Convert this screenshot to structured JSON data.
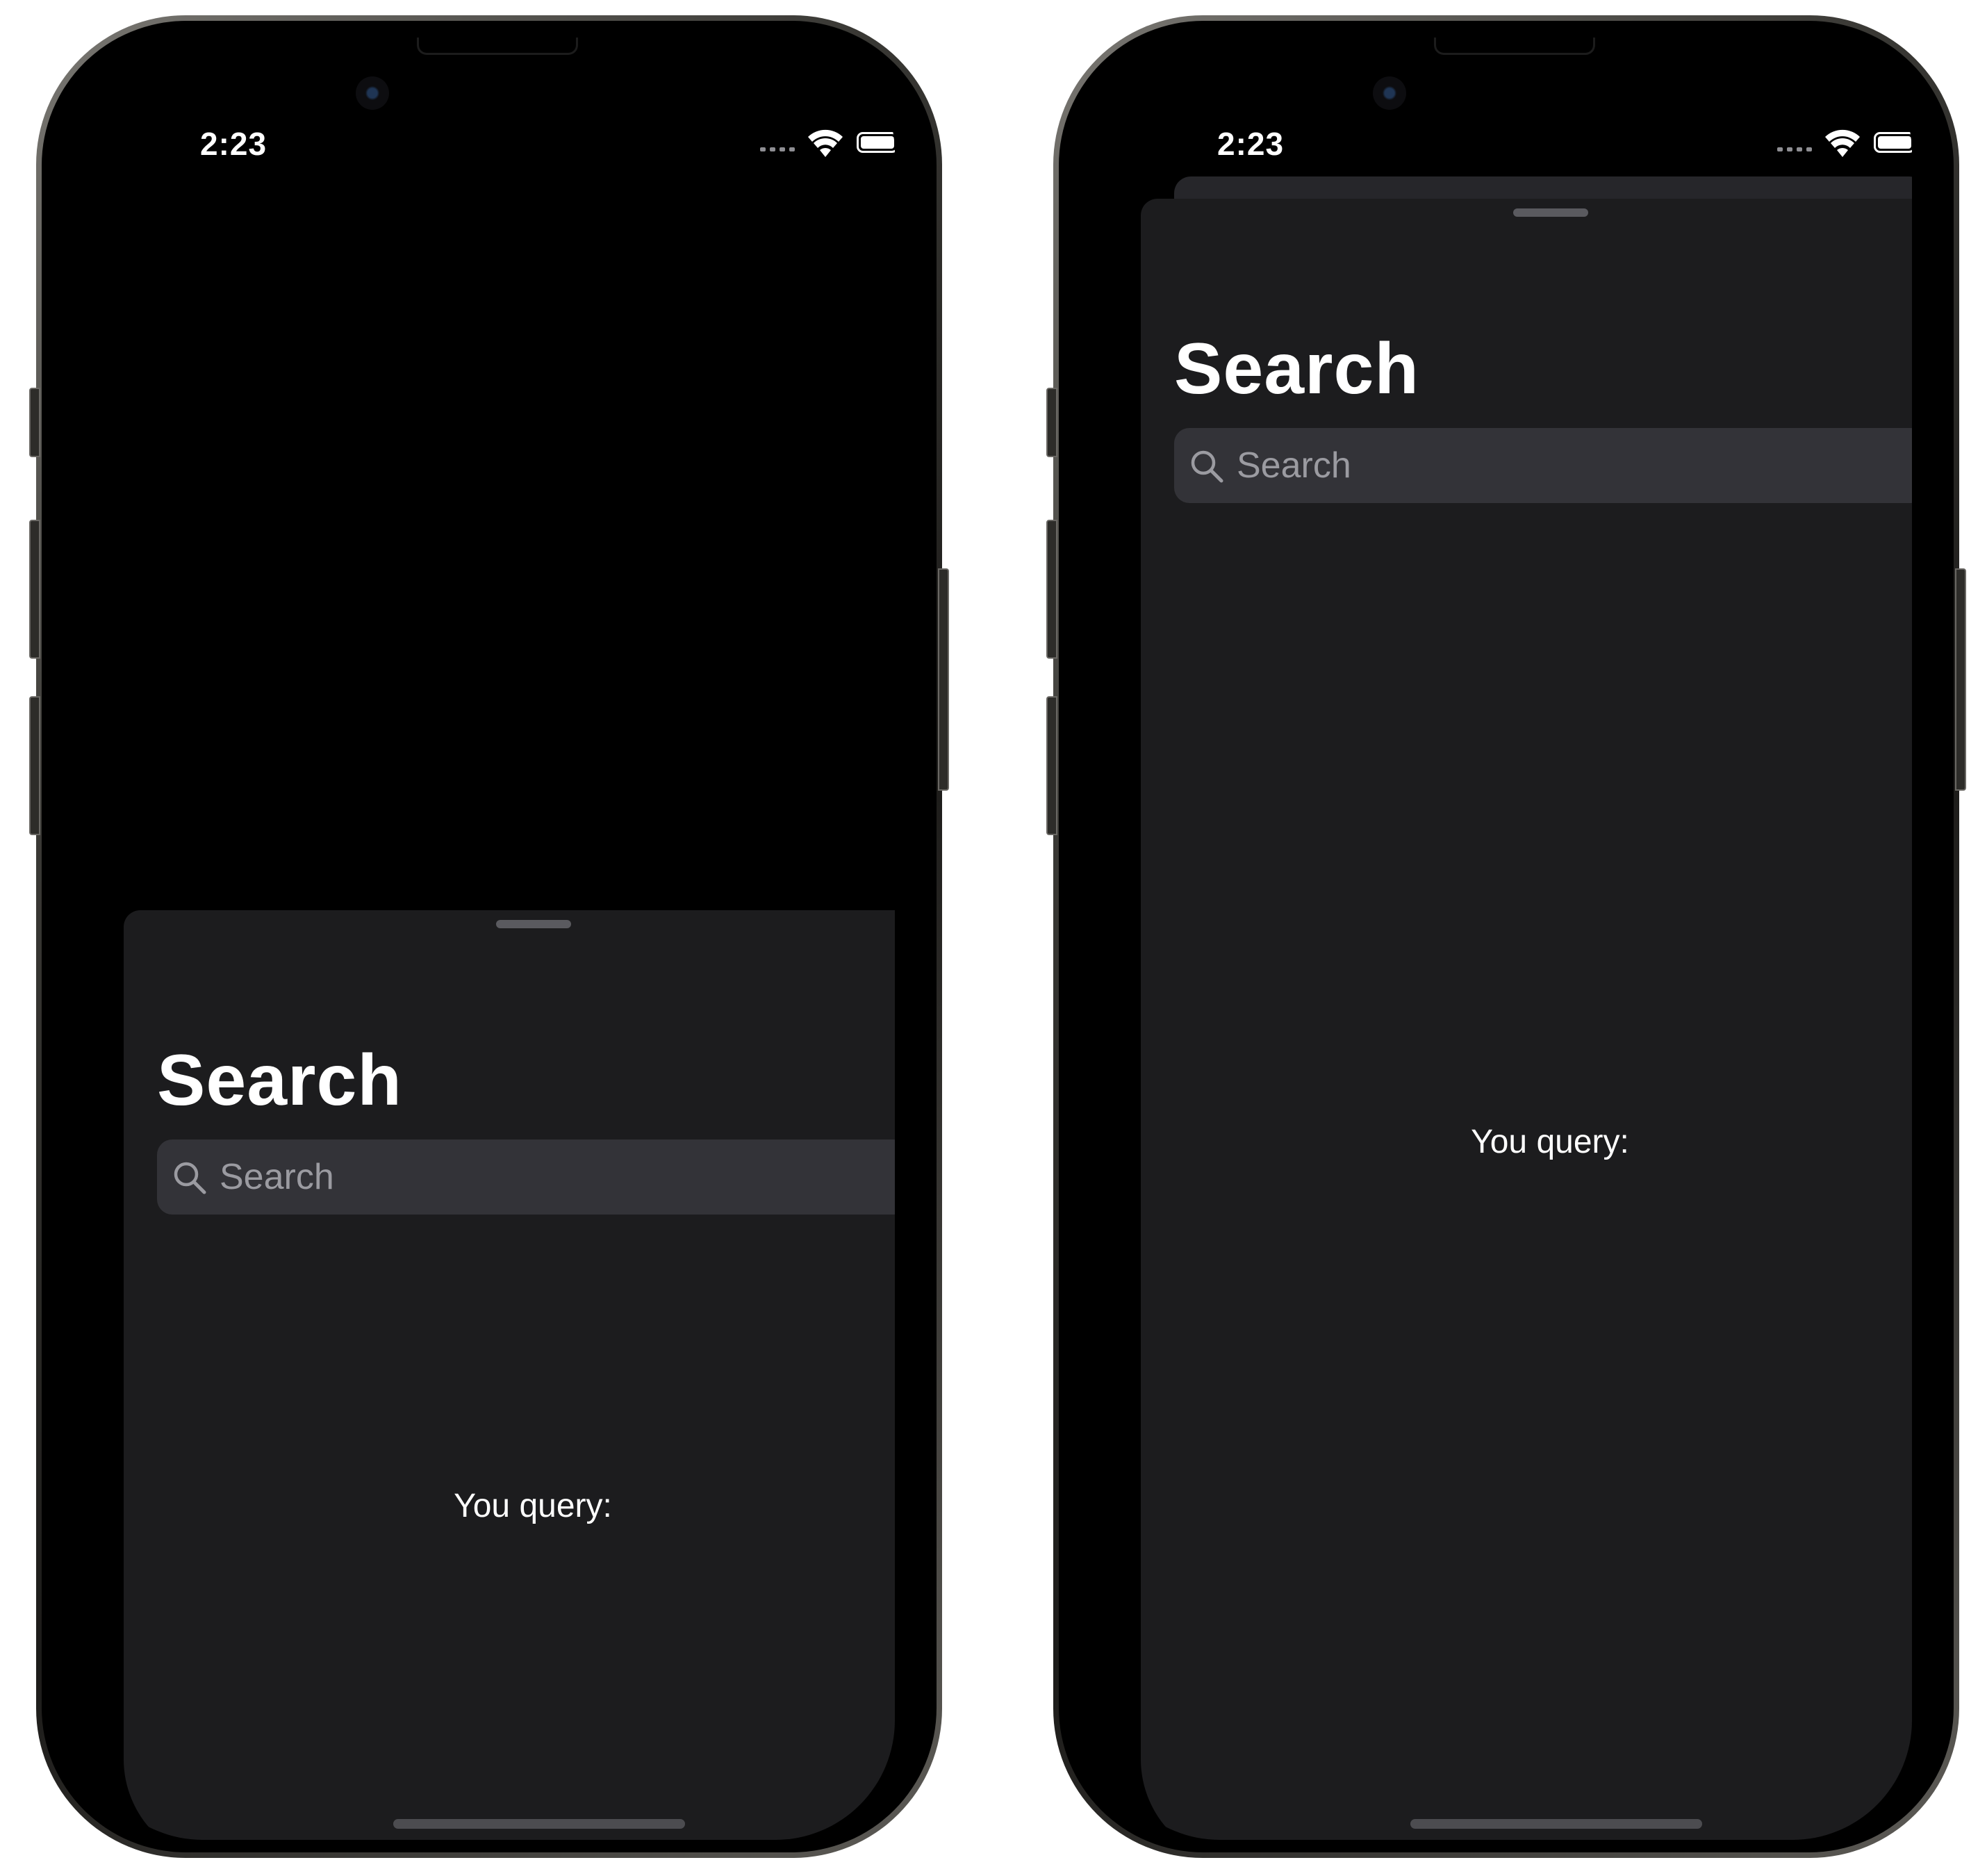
{
  "phones": [
    {
      "state": "sheet-medium",
      "status": {
        "time": "2:23"
      },
      "sheet": {
        "title": "Search",
        "search": {
          "placeholder": "Search",
          "value": ""
        },
        "query_label": "You query:"
      }
    },
    {
      "state": "sheet-large",
      "status": {
        "time": "2:23"
      },
      "sheet": {
        "title": "Search",
        "search": {
          "placeholder": "Search",
          "value": ""
        },
        "query_label": "You query:"
      }
    }
  ],
  "icons": {
    "signal": "cellular-signal-icon",
    "wifi": "wifi-icon",
    "battery": "battery-icon",
    "search": "magnifying-glass-icon"
  },
  "colors": {
    "sheet_background": "#1c1c1e",
    "search_field_background": "#333338",
    "placeholder_text": "#9b9ba1",
    "text": "#ffffff"
  }
}
